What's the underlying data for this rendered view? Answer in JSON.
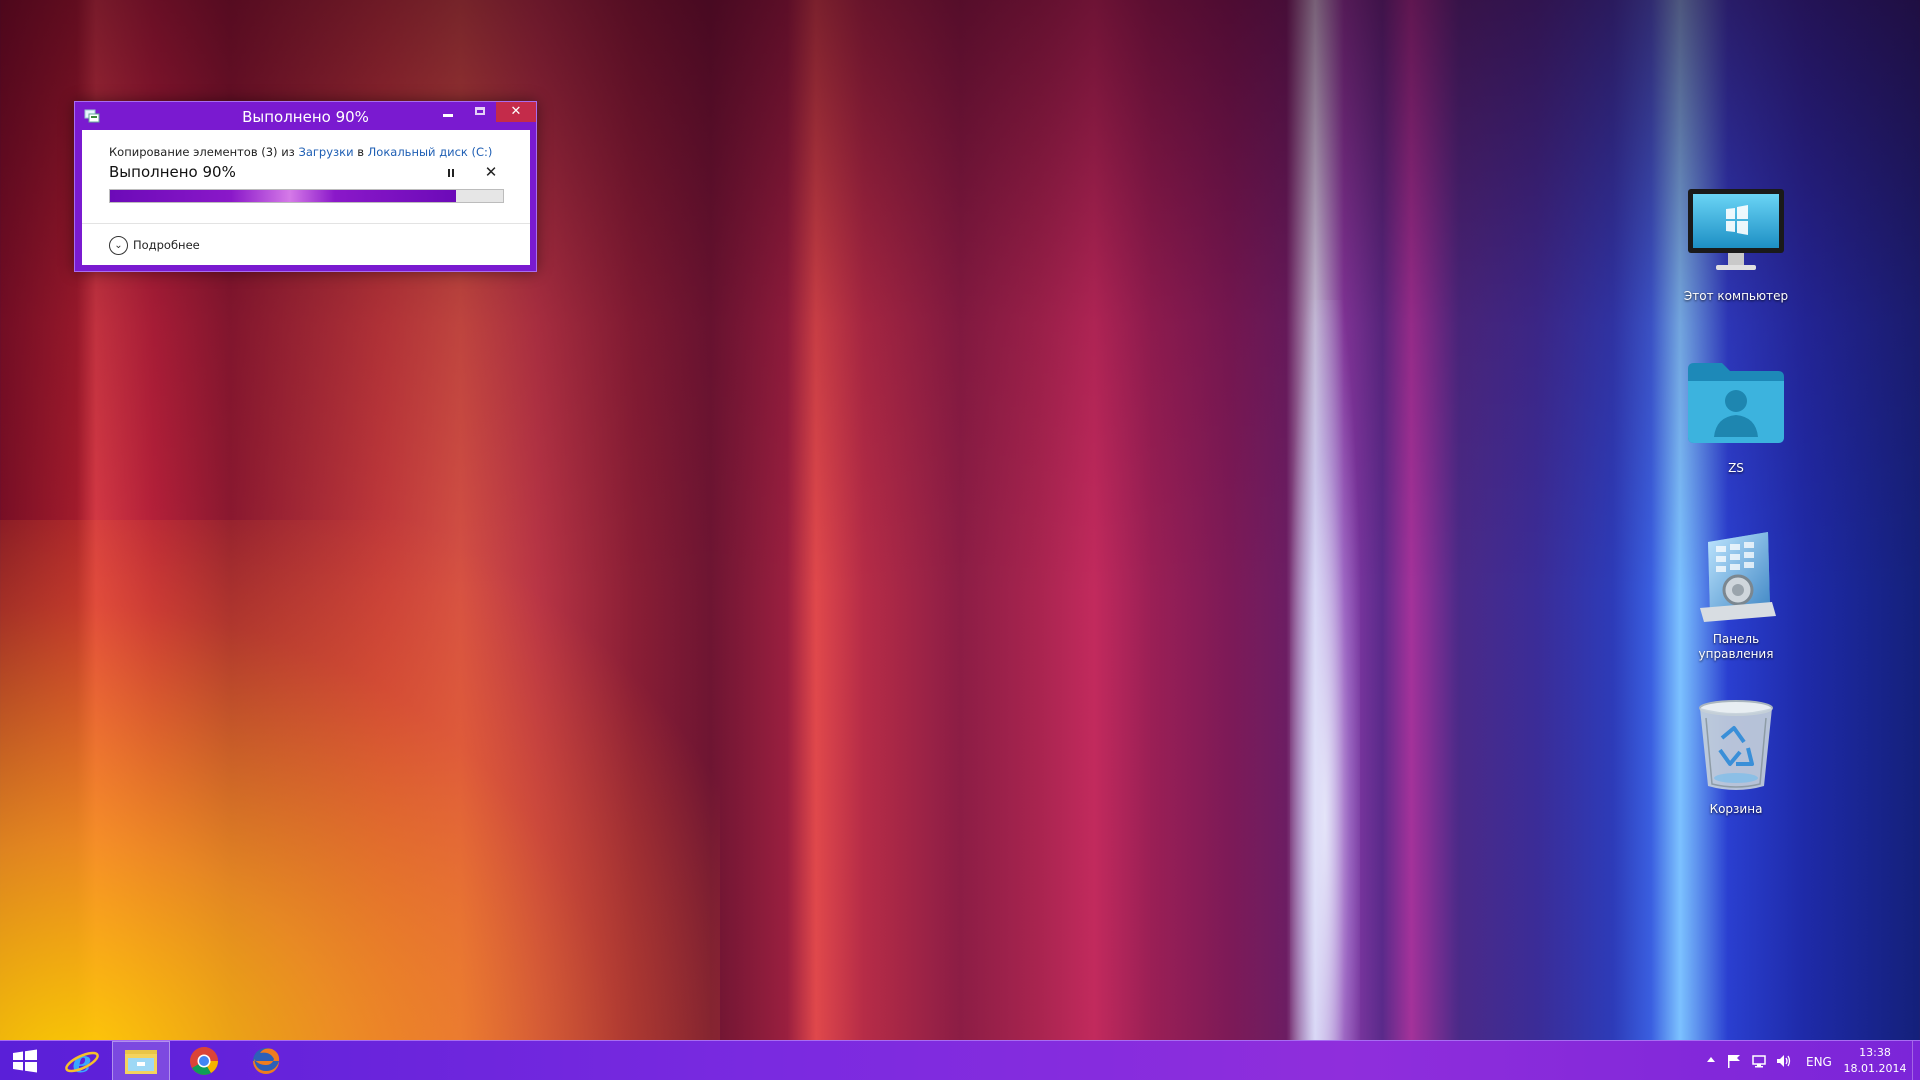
{
  "dialog": {
    "title": "Выполнено 90%",
    "copy_prefix": "Копирование элементов (3) из ",
    "source_link": "Загрузки",
    "copy_middle": " в ",
    "dest_link": "Локальный диск (C:)",
    "progress_label": "Выполнено 90%",
    "progress_fraction": 0.88,
    "details_label": "Подробнее"
  },
  "desktop_icons": [
    {
      "label": "Этот компьютер",
      "icon": "monitor-icon"
    },
    {
      "label": "ZS",
      "icon": "user-folder-icon"
    },
    {
      "label": "Панель управления",
      "icon": "control-panel-icon"
    },
    {
      "label": "Корзина",
      "icon": "recycle-bin-icon"
    }
  ],
  "taskbar": {
    "items": [
      "start-icon",
      "internet-explorer-icon",
      "file-explorer-icon",
      "chrome-icon",
      "firefox-icon"
    ],
    "language": "ENG",
    "time": "13:38",
    "date": "18.01.2014"
  },
  "colors": {
    "accent": "#7a1ad0",
    "close": "#c42b4a",
    "link": "#1f5fb4"
  }
}
